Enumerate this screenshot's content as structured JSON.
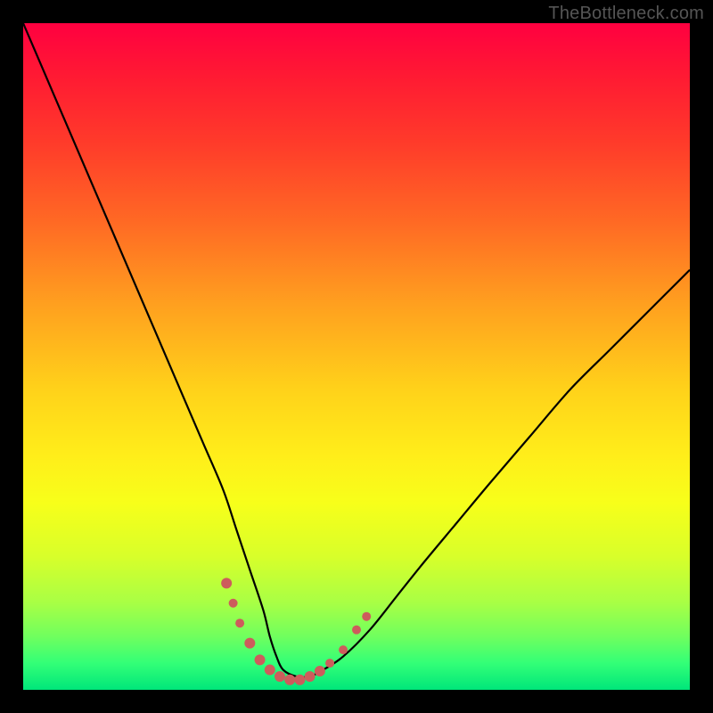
{
  "watermark": "TheBottleneck.com",
  "colors": {
    "frame": "#000000",
    "watermark": "#555555",
    "curve": "#000000",
    "marker": "#cd5c5c"
  },
  "chart_data": {
    "type": "line",
    "title": "",
    "xlabel": "",
    "ylabel": "",
    "xlim": [
      0,
      100
    ],
    "ylim": [
      0,
      100
    ],
    "grid": false,
    "legend": false,
    "series": [
      {
        "name": "bottleneck-curve",
        "x": [
          0,
          3,
          6,
          9,
          12,
          15,
          18,
          21,
          24,
          27,
          30,
          32,
          34,
          36,
          37,
          38,
          39,
          41,
          43,
          45,
          48,
          52,
          56,
          60,
          65,
          70,
          76,
          82,
          88,
          94,
          100
        ],
        "y": [
          100,
          93,
          86,
          79,
          72,
          65,
          58,
          51,
          44,
          37,
          30,
          24,
          18,
          12,
          8,
          5,
          3,
          2,
          2,
          3,
          5,
          9,
          14,
          19,
          25,
          31,
          38,
          45,
          51,
          57,
          63
        ]
      }
    ],
    "markers": [
      {
        "x": 30.5,
        "y": 16,
        "r": 6
      },
      {
        "x": 31.5,
        "y": 13,
        "r": 5
      },
      {
        "x": 32.5,
        "y": 10,
        "r": 5
      },
      {
        "x": 34.0,
        "y": 7,
        "r": 6
      },
      {
        "x": 35.5,
        "y": 4.5,
        "r": 6
      },
      {
        "x": 37.0,
        "y": 3.0,
        "r": 6
      },
      {
        "x": 38.5,
        "y": 2.0,
        "r": 6
      },
      {
        "x": 40.0,
        "y": 1.5,
        "r": 6
      },
      {
        "x": 41.5,
        "y": 1.5,
        "r": 6
      },
      {
        "x": 43.0,
        "y": 2.0,
        "r": 6
      },
      {
        "x": 44.5,
        "y": 2.8,
        "r": 6
      },
      {
        "x": 46.0,
        "y": 4.0,
        "r": 5
      },
      {
        "x": 48.0,
        "y": 6.0,
        "r": 5
      },
      {
        "x": 50.0,
        "y": 9.0,
        "r": 5
      },
      {
        "x": 51.5,
        "y": 11.0,
        "r": 5
      }
    ]
  }
}
